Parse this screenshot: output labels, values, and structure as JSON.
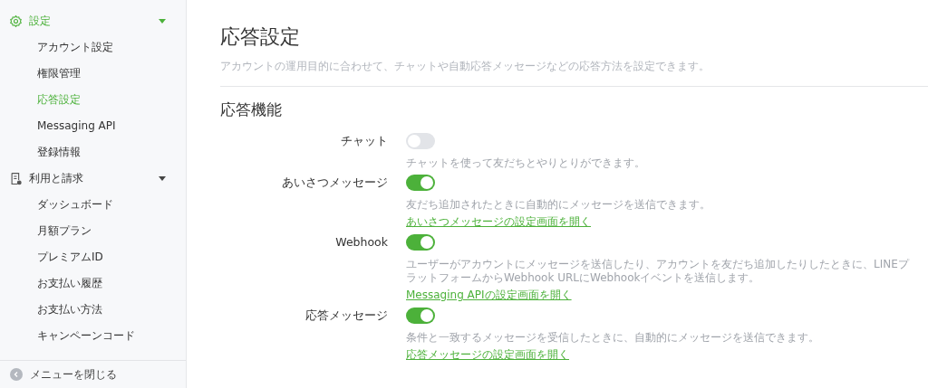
{
  "sidebar": {
    "sections": [
      {
        "label": "設定",
        "kind": "gear",
        "selected": true,
        "expanded": true,
        "items": [
          {
            "label": "アカウント設定",
            "selected": false
          },
          {
            "label": "権限管理",
            "selected": false
          },
          {
            "label": "応答設定",
            "selected": true
          },
          {
            "label": "Messaging API",
            "selected": false
          },
          {
            "label": "登録情報",
            "selected": false
          }
        ]
      },
      {
        "label": "利用と請求",
        "kind": "receipt",
        "selected": false,
        "expanded": true,
        "items": [
          {
            "label": "ダッシュボード",
            "selected": false
          },
          {
            "label": "月額プラン",
            "selected": false
          },
          {
            "label": "プレミアムID",
            "selected": false
          },
          {
            "label": "お支払い履歴",
            "selected": false
          },
          {
            "label": "お支払い方法",
            "selected": false
          },
          {
            "label": "キャンペーンコード",
            "selected": false
          }
        ]
      }
    ],
    "footer": "メニューを閉じる"
  },
  "page": {
    "title": "応答設定",
    "subtitle": "アカウントの運用目的に合わせて、チャットや自動応答メッセージなどの応答方法を設定できます。",
    "section_title": "応答機能",
    "settings": [
      {
        "label": "チャット",
        "on": false,
        "description": "チャットを使って友だちとやりとりができます。"
      },
      {
        "label": "あいさつメッセージ",
        "on": true,
        "description": "友だち追加されたときに自動的にメッセージを送信できます。",
        "link": "あいさつメッセージの設定画面を開く"
      },
      {
        "label": "Webhook",
        "on": true,
        "description": "ユーザーがアカウントにメッセージを送信したり、アカウントを友だち追加したりしたときに、LINEプラットフォームからWebhook URLにWebhookイベントを送信します。",
        "link": "Messaging APIの設定画面を開く"
      },
      {
        "label": "応答メッセージ",
        "on": true,
        "description": "条件と一致するメッセージを受信したときに、自動的にメッセージを送信できます。",
        "link": "応答メッセージの設定画面を開く"
      }
    ]
  }
}
